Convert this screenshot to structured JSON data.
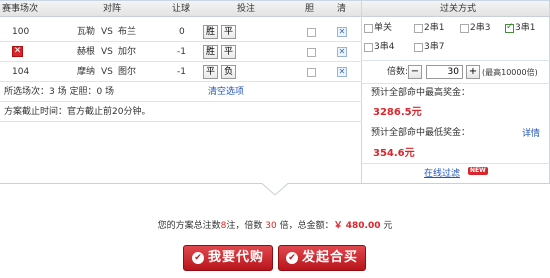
{
  "headers": {
    "match_no": "赛事场次",
    "versus": "对阵",
    "handicap": "让球",
    "bet": "投注",
    "banker": "胆",
    "clear": "清",
    "pass_type": "过关方式"
  },
  "matches": [
    {
      "no": "100",
      "home": "瓦勒",
      "vs": "VS",
      "away": "布兰",
      "handicap": "0",
      "bets": [
        "胜",
        "平"
      ],
      "removed": false
    },
    {
      "no": "",
      "home": "赫根",
      "vs": "VS",
      "away": "加尔",
      "handicap": "-1",
      "bets": [
        "胜",
        "平"
      ],
      "removed": true
    },
    {
      "no": "104",
      "home": "摩纳",
      "vs": "VS",
      "away": "图尔",
      "handicap": "-1",
      "bets": [
        "平",
        "负"
      ],
      "removed": false
    }
  ],
  "summary_left": "所选场次：3 场 定胆：0 场",
  "clear_selection": "清空选项",
  "deadline": "方案截止时间：官方截止前20分钟。",
  "pass_options": [
    {
      "label": "单关",
      "checked": false
    },
    {
      "label": "2串1",
      "checked": false
    },
    {
      "label": "2串3",
      "checked": false
    },
    {
      "label": "3串1",
      "checked": true
    },
    {
      "label": "3串4",
      "checked": false
    },
    {
      "label": "3串7",
      "checked": false
    }
  ],
  "multiplier": {
    "label": "倍数:",
    "minus": "−",
    "value": "30",
    "plus": "+",
    "max_note": "(最高10000倍)"
  },
  "max_prize_label": "预计全部命中最高奖金：",
  "max_prize": "3286.5元",
  "min_prize_label": "预计全部命中最低奖金：",
  "min_prize": "354.6元",
  "details_link": "详情",
  "online_filter": "在线过滤",
  "new_badge": "NEW",
  "total": {
    "prefix": "您的方案总注数",
    "bets": "8",
    "mid1": "注，倍数",
    "multiple": "30",
    "mid2": "倍，总金额：",
    "amount": "￥ 480.00",
    "suffix": "元"
  },
  "buttons": {
    "agent": "我要代购",
    "join": "发起合买",
    "agent_icon": "check-circle-icon",
    "join_icon": "check-circle-icon"
  },
  "colors": {
    "accent_red": "#d9262c",
    "link_blue": "#2255bb"
  }
}
